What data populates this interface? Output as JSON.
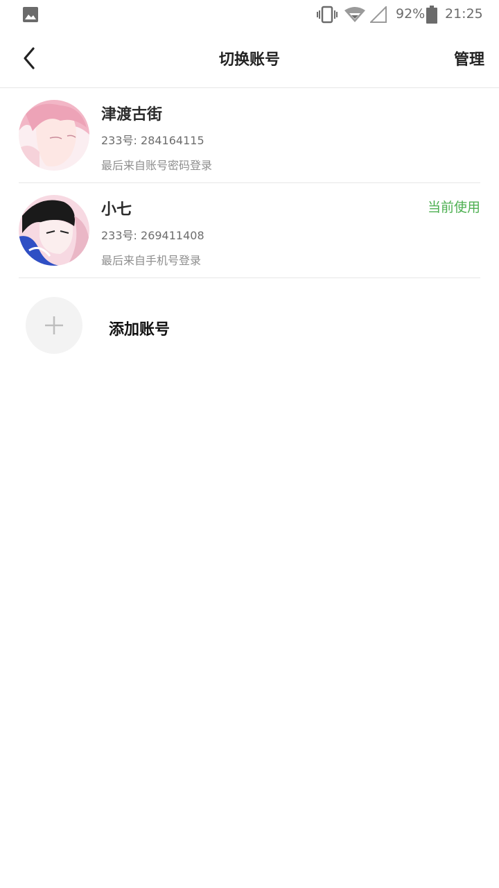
{
  "status_bar": {
    "battery_percent": "92%",
    "time": "21:25",
    "icons": [
      "gallery-icon",
      "vibrate-icon",
      "wifi-icon",
      "signal-icon",
      "battery-icon"
    ]
  },
  "header": {
    "title": "切换账号",
    "manage_label": "管理"
  },
  "accounts": [
    {
      "name": "津渡古街",
      "id_text": "233号: 284164115",
      "login_text": "最后来自账号密码登录",
      "current_label": ""
    },
    {
      "name": "小七",
      "id_text": "233号: 269411408",
      "login_text": "最后来自手机号登录",
      "current_label": "当前使用"
    }
  ],
  "add_account": {
    "label": "添加账号"
  },
  "colors": {
    "accent_green": "#4caf50",
    "divider": "#e6e6e6",
    "text_primary": "#222222",
    "text_secondary": "#6d6d6d"
  }
}
